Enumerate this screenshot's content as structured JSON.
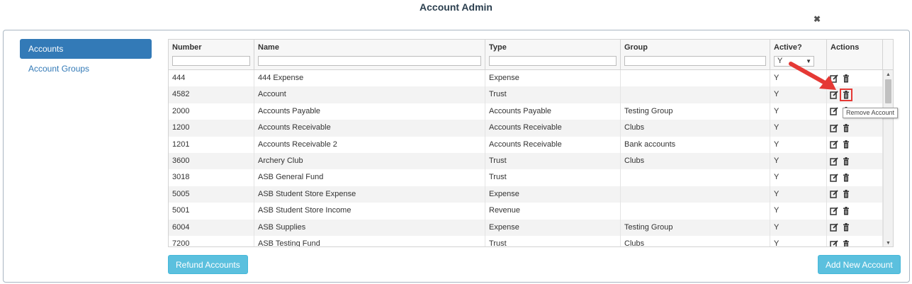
{
  "page": {
    "title": "Account Admin"
  },
  "sidebar": {
    "items": [
      {
        "label": "Accounts",
        "active": true
      },
      {
        "label": "Account Groups",
        "active": false
      }
    ]
  },
  "table": {
    "columns": [
      "Number",
      "Name",
      "Type",
      "Group",
      "Active?",
      "Actions"
    ],
    "active_filter_value": "Y",
    "rows": [
      {
        "number": "444",
        "name": "444 Expense",
        "type": "Expense",
        "group": "",
        "active": "Y"
      },
      {
        "number": "4582",
        "name": "Account",
        "type": "Trust",
        "group": "",
        "active": "Y"
      },
      {
        "number": "2000",
        "name": "Accounts Payable",
        "type": "Accounts Payable",
        "group": "Testing Group",
        "active": "Y"
      },
      {
        "number": "1200",
        "name": "Accounts Receivable",
        "type": "Accounts Receivable",
        "group": "Clubs",
        "active": "Y"
      },
      {
        "number": "1201",
        "name": "Accounts Receivable 2",
        "type": "Accounts Receivable",
        "group": "Bank accounts",
        "active": "Y"
      },
      {
        "number": "3600",
        "name": "Archery Club",
        "type": "Trust",
        "group": "Clubs",
        "active": "Y"
      },
      {
        "number": "3018",
        "name": "ASB General Fund",
        "type": "Trust",
        "group": "",
        "active": "Y"
      },
      {
        "number": "5005",
        "name": "ASB Student Store Expense",
        "type": "Expense",
        "group": "",
        "active": "Y"
      },
      {
        "number": "5001",
        "name": "ASB Student Store Income",
        "type": "Revenue",
        "group": "",
        "active": "Y"
      },
      {
        "number": "6004",
        "name": "ASB Supplies",
        "type": "Expense",
        "group": "Testing Group",
        "active": "Y"
      },
      {
        "number": "7200",
        "name": "ASB Testing Fund",
        "type": "Trust",
        "group": "Clubs",
        "active": "Y"
      }
    ],
    "row_actions": {
      "edit_icon": "edit-icon",
      "delete_icon": "trash-icon"
    }
  },
  "tooltip": {
    "text": "Remove Account"
  },
  "buttons": {
    "refund_label": "Refund Accounts",
    "add_label": "Add New Account"
  },
  "colors": {
    "primary": "#337ab7",
    "info_button": "#5bc0de",
    "highlight": "#e53935",
    "title": "#2b3f4f"
  }
}
